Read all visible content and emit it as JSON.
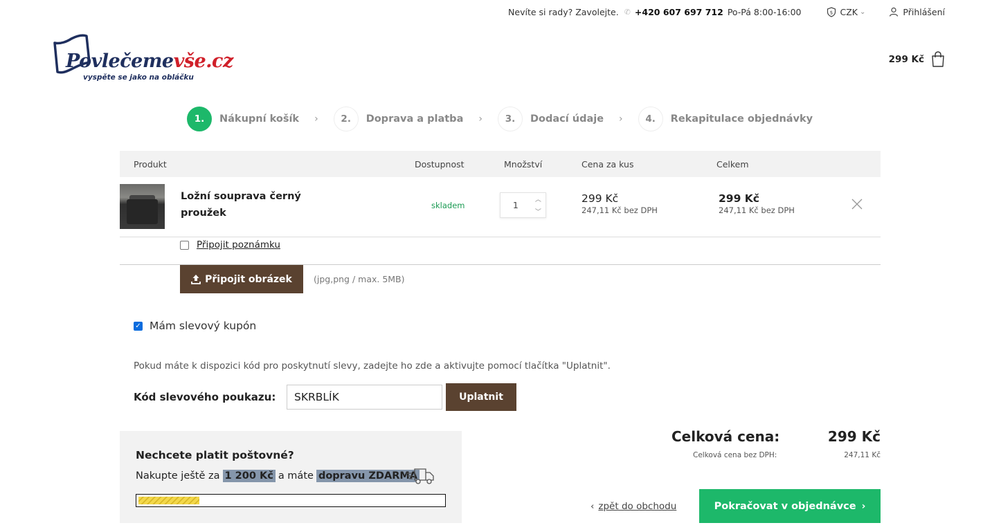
{
  "topbar": {
    "help_text": "Nevíte si rady? Zavolejte.",
    "phone": "+420 607 697 712",
    "hours": "Po-Pá 8:00-16:00",
    "currency": "CZK",
    "login": "Přihlášení"
  },
  "logo": {
    "brand_main": "Povlečeme",
    "brand_accent": "vše.cz",
    "tagline": "vyspěte se jako na obláčku"
  },
  "cart": {
    "total": "299 Kč"
  },
  "steps": [
    {
      "num": "1.",
      "label": "Nákupní košík",
      "active": true
    },
    {
      "num": "2.",
      "label": "Doprava a platba",
      "active": false
    },
    {
      "num": "3.",
      "label": "Dodací údaje",
      "active": false
    },
    {
      "num": "4.",
      "label": "Rekapitulace objednávky",
      "active": false
    }
  ],
  "table": {
    "headers": {
      "product": "Produkt",
      "availability": "Dostupnost",
      "quantity": "Množství",
      "unit_price": "Cena za kus",
      "total": "Celkem"
    },
    "item": {
      "name": "Ložní souprava černý proužek",
      "availability": "skladem",
      "quantity": "1",
      "unit_price": "299 Kč",
      "unit_price_net": "247,11 Kč bez DPH",
      "total_price": "299 Kč",
      "total_price_net": "247,11 Kč bez DPH",
      "note_link": "Připojit poznámku",
      "upload_button": "Připojit obrázek",
      "upload_hint": "(jpg,png / max. 5MB)"
    }
  },
  "coupon": {
    "checkbox_label": "Mám slevový kupón",
    "checked": true,
    "description": "Pokud máte k dispozici kód pro poskytnutí slevy, zadejte ho zde a aktivujte pomocí tlačítka \"Uplatnit\".",
    "field_label": "Kód slevového poukazu:",
    "value": "SKRBLÍK",
    "apply_button": "Uplatnit"
  },
  "shipping": {
    "title": "Nechcete platit poštovné?",
    "text_before": "Nakupte ještě za",
    "amount": "1 200 Kč",
    "text_middle": "a máte",
    "highlight": "dopravu ZDARMA",
    "progress": 0.2
  },
  "summary": {
    "total_label": "Celková cena:",
    "total_value": "299 Kč",
    "net_label": "Celková cena bez DPH:",
    "net_value": "247,11 Kč"
  },
  "actions": {
    "back": "zpět do obchodu",
    "continue": "Pokračovat v objednávce"
  },
  "colors": {
    "accent_green": "#1db86a",
    "brown_button": "#5a4230",
    "brand_navy": "#1f2f5e",
    "brand_red": "#d0202a"
  }
}
